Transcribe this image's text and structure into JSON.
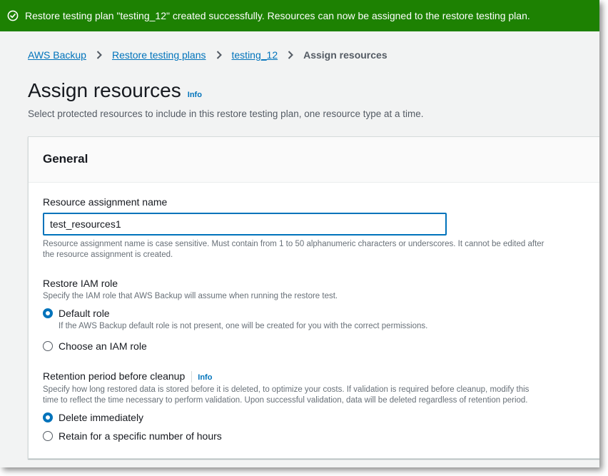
{
  "flash": {
    "icon": "check-circle-icon",
    "message": "Restore testing plan \"testing_12\" created successfully. Resources can now be assigned to the restore testing plan.",
    "color": "#1d8102"
  },
  "breadcrumb": {
    "items": [
      "AWS Backup",
      "Restore testing plans",
      "testing_12"
    ],
    "current": "Assign resources"
  },
  "page": {
    "title": "Assign resources",
    "info_link": "Info",
    "subtitle": "Select protected resources to include in this restore testing plan, one resource type at a time."
  },
  "general": {
    "heading": "General",
    "name_label": "Resource assignment name",
    "name_value": "test_resources1",
    "name_help_1": "Resource assignment name is case sensitive. Must contain from 1 to 50 alphanumeric characters or underscores. It cannot be edited after",
    "name_help_2": "the resource assignment is created.",
    "iam_label": "Restore IAM role",
    "iam_desc": "Specify the IAM role that AWS Backup will assume when running the restore test.",
    "iam_options": [
      {
        "label": "Default role",
        "desc": "If the AWS Backup default role is not present, one will be created for you with the correct permissions.",
        "selected": true
      },
      {
        "label": "Choose an IAM role",
        "selected": false
      }
    ],
    "retention_label": "Retention period before cleanup",
    "retention_info": "Info",
    "retention_desc_1": "Specify how long restored data is stored before it is deleted, to optimize your costs. If validation is required before cleanup, modify this",
    "retention_desc_2": "time to reflect the time necessary to perform validation. Upon successful validation, data will be deleted regardless of retention period.",
    "retention_options": [
      {
        "label": "Delete immediately",
        "selected": true
      },
      {
        "label": "Retain for a specific number of hours",
        "selected": false
      }
    ]
  },
  "colors": {
    "link": "#0073bb",
    "success": "#1d8102",
    "text": "#16191f",
    "muted": "#687078"
  }
}
